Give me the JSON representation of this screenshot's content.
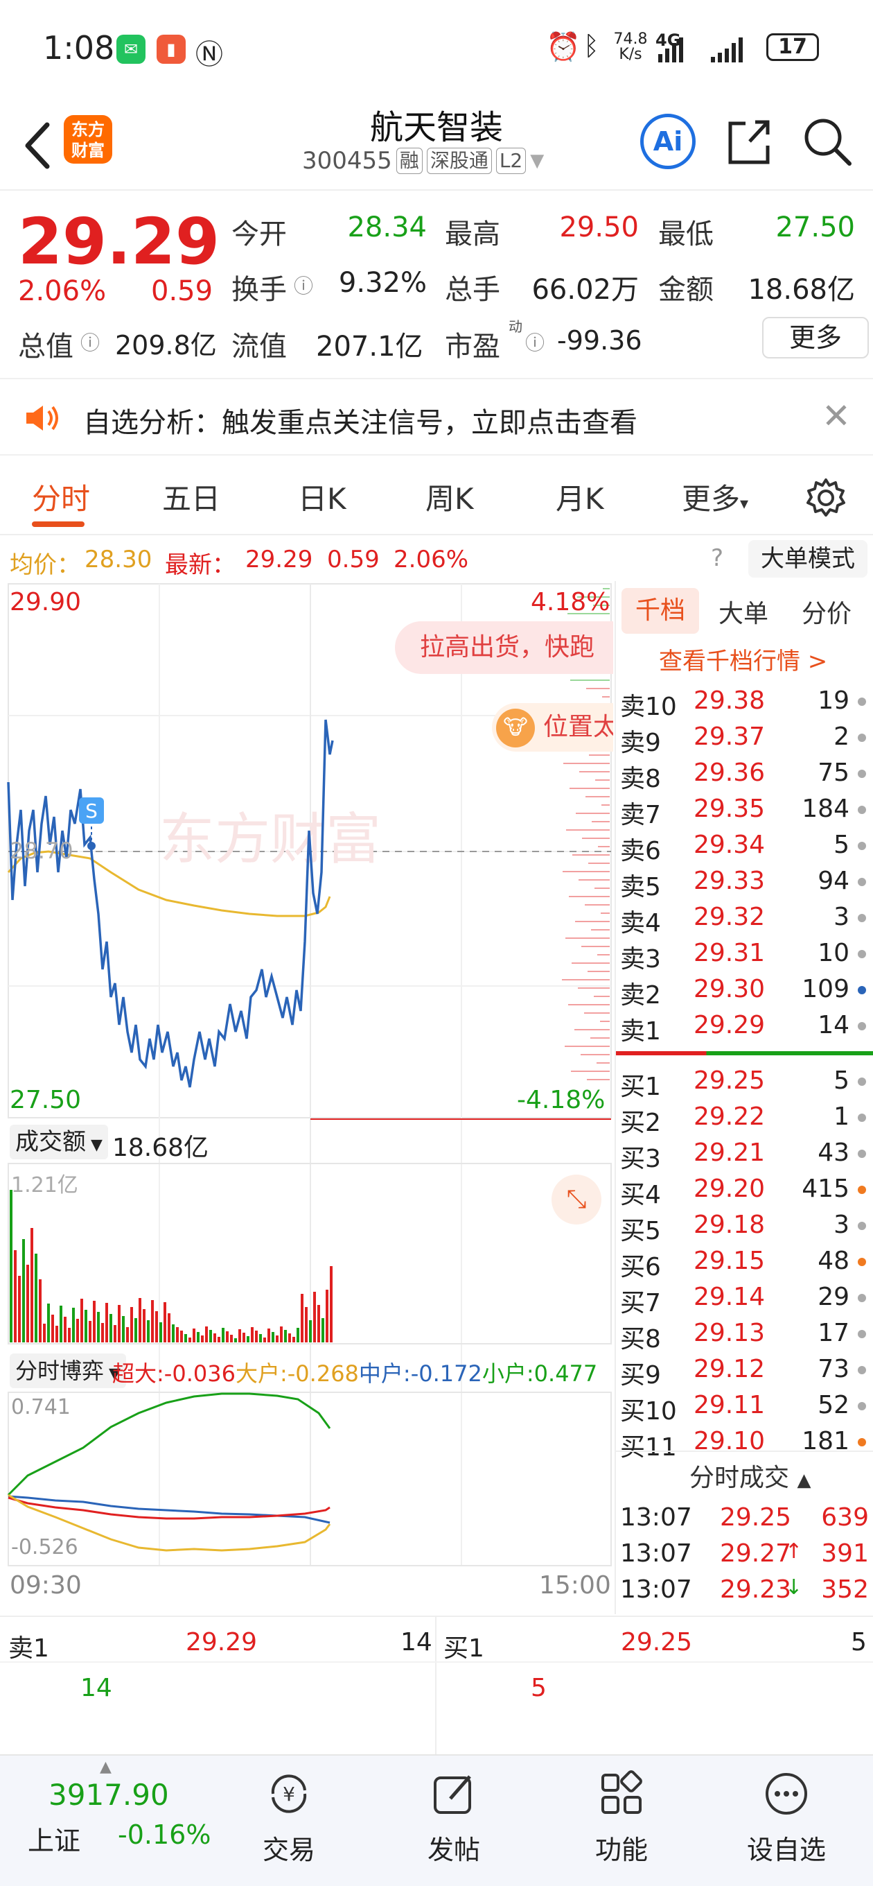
{
  "status": {
    "time": "1:08",
    "net_speed_top": "74.8",
    "net_speed_bottom": "K/s",
    "network": "4G",
    "battery": "17"
  },
  "header": {
    "logo_line1": "东方",
    "logo_line2": "财富",
    "stock_name": "航天智装",
    "stock_code": "300455",
    "tags": [
      "融",
      "深股通",
      "L2"
    ],
    "ai_label": "Ai"
  },
  "quote": {
    "price": "29.29",
    "change_pct": "2.06%",
    "change_amt": "0.59",
    "open_label": "今开",
    "open_value": "28.34",
    "high_label": "最高",
    "high_value": "29.50",
    "low_label": "最低",
    "low_value": "27.50",
    "turnover_label": "换手",
    "turnover_value": "9.32%",
    "volume_label": "总手",
    "volume_value": "66.02万",
    "amount_label": "金额",
    "amount_value": "18.68亿",
    "mktcap_label": "总值",
    "mktcap_value": "209.8亿",
    "float_label": "流值",
    "float_value": "207.1亿",
    "pe_label": "市盈",
    "pe_sup": "动",
    "pe_value": "-99.36",
    "more_label": "更多"
  },
  "alert": {
    "text": "自选分析：触发重点关注信号，立即点击查看"
  },
  "tabs": [
    "分时",
    "五日",
    "日K",
    "周K",
    "月K",
    "更多"
  ],
  "infostrip": {
    "avg_label": "均价：",
    "avg_value": "28.30",
    "latest_label": "最新：",
    "latest_value": "29.29",
    "latest_change": "0.59",
    "latest_pct": "2.06%",
    "bigorder_label": "大单模式"
  },
  "chart": {
    "price_top": "29.90",
    "price_mid": "28.70",
    "price_bottom": "27.50",
    "pct_top": "4.18%",
    "pct_bottom": "-4.18%",
    "s_marker": "S",
    "bubble1": "拉高出货，快跑",
    "bubble2": "位置太",
    "watermark": "东方财富",
    "volume_label": "成交额",
    "volume_total": "18.68亿",
    "volume_max": "1.21亿",
    "flow_label": "分时博弈",
    "flow_super_label": "超大:",
    "flow_super_value": "-0.036",
    "flow_big_label": "大户:",
    "flow_big_value": "-0.268",
    "flow_mid_label": "中户:",
    "flow_mid_value": "-0.172",
    "flow_small_label": "小户:",
    "flow_small_value": "0.477",
    "flow_max": "0.741",
    "flow_min": "-0.526",
    "time_start": "09:30",
    "time_end": "15:00",
    "colors": {
      "price": "#2a64b8",
      "avg": "#e8b830",
      "up": "#e02020",
      "down": "#18a018"
    }
  },
  "book": {
    "tabs": [
      "千档",
      "大单",
      "分价"
    ],
    "link": "查看千档行情 >",
    "asks": [
      {
        "label": "卖10",
        "price": "29.38",
        "vol": "19",
        "dot": "gray"
      },
      {
        "label": "卖9",
        "price": "29.37",
        "vol": "2",
        "dot": "gray"
      },
      {
        "label": "卖8",
        "price": "29.36",
        "vol": "75",
        "dot": "gray"
      },
      {
        "label": "卖7",
        "price": "29.35",
        "vol": "184",
        "dot": "gray"
      },
      {
        "label": "卖6",
        "price": "29.34",
        "vol": "5",
        "dot": "gray"
      },
      {
        "label": "卖5",
        "price": "29.33",
        "vol": "94",
        "dot": "gray"
      },
      {
        "label": "卖4",
        "price": "29.32",
        "vol": "3",
        "dot": "gray"
      },
      {
        "label": "卖3",
        "price": "29.31",
        "vol": "10",
        "dot": "gray"
      },
      {
        "label": "卖2",
        "price": "29.30",
        "vol": "109",
        "dot": "blue"
      },
      {
        "label": "卖1",
        "price": "29.29",
        "vol": "14",
        "dot": "gray"
      }
    ],
    "bids": [
      {
        "label": "买1",
        "price": "29.25",
        "vol": "5",
        "dot": "gray"
      },
      {
        "label": "买2",
        "price": "29.22",
        "vol": "1",
        "dot": "gray"
      },
      {
        "label": "买3",
        "price": "29.21",
        "vol": "43",
        "dot": "gray"
      },
      {
        "label": "买4",
        "price": "29.20",
        "vol": "415",
        "dot": "orange"
      },
      {
        "label": "买5",
        "price": "29.18",
        "vol": "3",
        "dot": "gray"
      },
      {
        "label": "买6",
        "price": "29.15",
        "vol": "48",
        "dot": "orange"
      },
      {
        "label": "买7",
        "price": "29.14",
        "vol": "29",
        "dot": "gray"
      },
      {
        "label": "买8",
        "price": "29.13",
        "vol": "17",
        "dot": "gray"
      },
      {
        "label": "买9",
        "price": "29.12",
        "vol": "73",
        "dot": "gray"
      },
      {
        "label": "买10",
        "price": "29.11",
        "vol": "52",
        "dot": "gray"
      },
      {
        "label": "买11",
        "price": "29.10",
        "vol": "181",
        "dot": "orange"
      }
    ],
    "ticks_title": "分时成交",
    "ticks": [
      {
        "time": "13:07",
        "price": "29.25",
        "arrow": "",
        "vol": "639"
      },
      {
        "time": "13:07",
        "price": "29.27",
        "arrow": "↑",
        "vol": "391"
      },
      {
        "time": "13:07",
        "price": "29.23",
        "arrow": "↓",
        "vol": "352"
      }
    ]
  },
  "bottomquote": {
    "sell_label": "卖1",
    "sell_price": "29.29",
    "sell_vol": "14",
    "sell_sub": "14",
    "buy_label": "买1",
    "buy_price": "29.25",
    "buy_vol": "5",
    "buy_sub": "5"
  },
  "nav": {
    "index_value": "3917.90",
    "index_name": "上证",
    "index_pct": "-0.16%",
    "items": [
      "交易",
      "发帖",
      "功能",
      "设自选"
    ]
  }
}
